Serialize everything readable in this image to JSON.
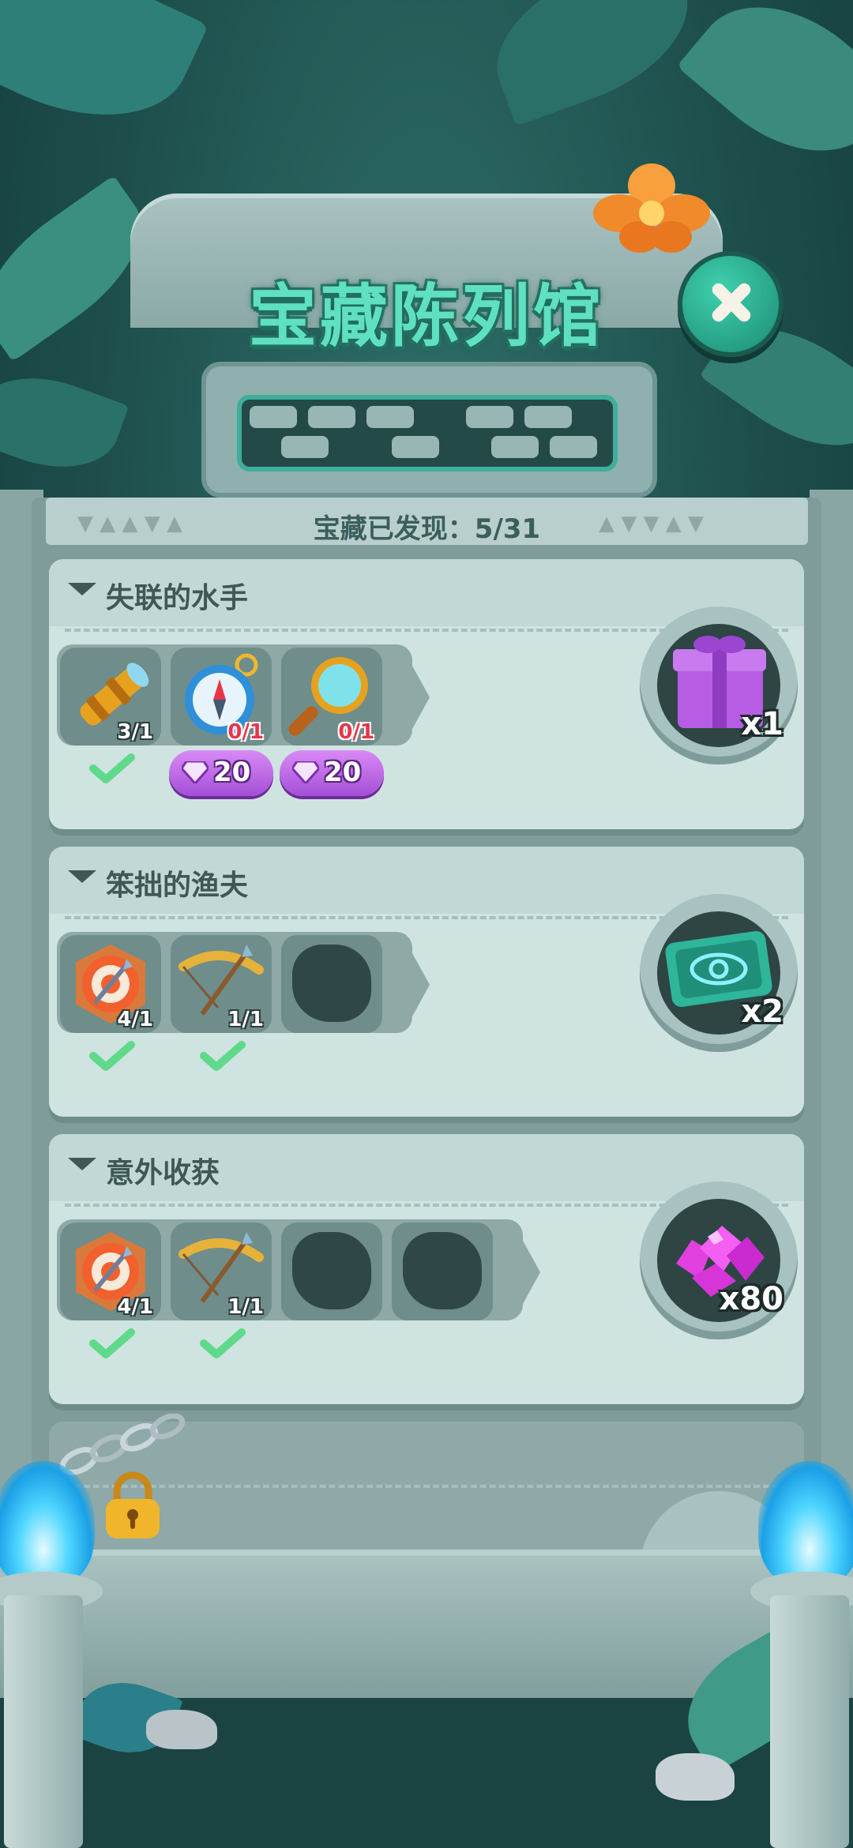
{
  "title": "宝藏陈列馆",
  "counter": {
    "label": "宝藏已发现：",
    "value": "5/31"
  },
  "sets": [
    {
      "title": "失联的水手",
      "items": [
        {
          "icon": "spyglass-icon",
          "count": "3/1",
          "collected": true
        },
        {
          "icon": "compass-icon",
          "count": "0/1",
          "collected": false,
          "gem_cost": "20"
        },
        {
          "icon": "magnifier-icon",
          "count": "0/1",
          "collected": false,
          "gem_cost": "20"
        }
      ],
      "reward": {
        "icon": "gift-box-icon",
        "qty": "x1"
      }
    },
    {
      "title": "笨拙的渔夫",
      "items": [
        {
          "icon": "arrow-target-icon",
          "count": "4/1",
          "collected": true
        },
        {
          "icon": "bow-arrow-icon",
          "count": "1/1",
          "collected": true
        },
        {
          "icon": "locked-slot-icon",
          "locked": true
        }
      ],
      "reward": {
        "icon": "eye-ticket-icon",
        "qty": "x2"
      }
    },
    {
      "title": "意外收获",
      "items": [
        {
          "icon": "arrow-target-icon",
          "count": "4/1",
          "collected": true
        },
        {
          "icon": "bow-arrow-icon",
          "count": "1/1",
          "collected": true
        },
        {
          "icon": "locked-slot-icon",
          "locked": true
        },
        {
          "icon": "locked-slot-icon",
          "locked": true
        }
      ],
      "reward": {
        "icon": "gems-pile-icon",
        "qty": "x80"
      }
    }
  ],
  "colors": {
    "accent_teal": "#5fe0c1",
    "gem_purple": "#b65de3",
    "check_green": "#5fd98a",
    "red_count": "#e8354a"
  }
}
